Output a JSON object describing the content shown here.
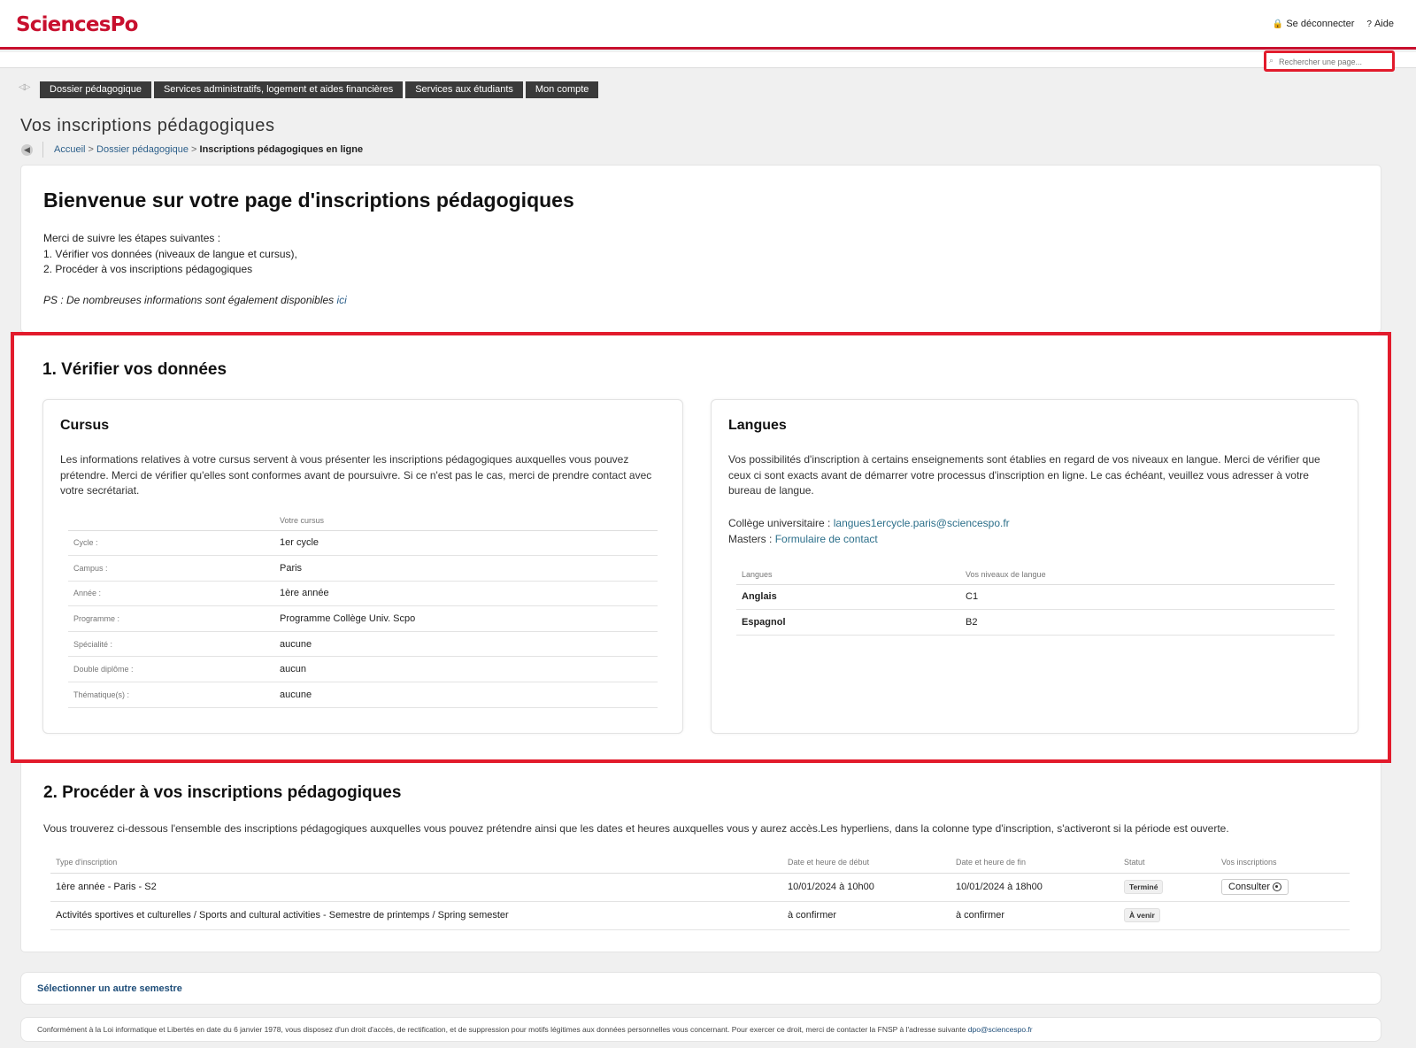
{
  "header": {
    "logo": "SciencesPo",
    "logout_label": "Se déconnecter",
    "help_label": "Aide"
  },
  "search": {
    "placeholder": "Rechercher une page..."
  },
  "nav": {
    "tabs": [
      "Dossier pédagogique",
      "Services administratifs, logement et aides financières",
      "Services aux étudiants",
      "Mon compte"
    ]
  },
  "page": {
    "title": "Vos inscriptions pédagogiques",
    "breadcrumb": {
      "home": "Accueil",
      "parent": "Dossier pédagogique",
      "current": "Inscriptions pédagogiques en ligne"
    }
  },
  "welcome": {
    "heading": "Bienvenue sur votre page d'inscriptions pédagogiques",
    "steps_intro": "Merci de suivre les étapes suivantes :",
    "step1": "1. Vérifier vos données (niveaux de langue et cursus),",
    "step2": "2. Procéder à vos inscriptions pédagogiques",
    "ps_text": "PS : De nombreuses informations sont également disponibles ",
    "ps_link": "ici"
  },
  "section1": {
    "title": "1. Vérifier vos données",
    "cursus": {
      "title": "Cursus",
      "description": "Les informations relatives à votre cursus servent à vous présenter les inscriptions pédagogiques auxquelles vous pouvez prétendre. Merci de vérifier qu'elles sont conformes avant de poursuivre. Si ce n'est pas le cas, merci de prendre contact avec votre secrétariat.",
      "column_header": "Votre cursus",
      "rows": [
        {
          "label": "Cycle :",
          "value": "1er cycle"
        },
        {
          "label": "Campus :",
          "value": "Paris"
        },
        {
          "label": "Année :",
          "value": "1ère année"
        },
        {
          "label": "Programme :",
          "value": "Programme Collège Univ. Scpo"
        },
        {
          "label": "Spécialité :",
          "value": "aucune"
        },
        {
          "label": "Double diplôme :",
          "value": "aucun"
        },
        {
          "label": "Thématique(s) :",
          "value": "aucune"
        }
      ]
    },
    "langues": {
      "title": "Langues",
      "description": "Vos possibilités d'inscription à certains enseignements sont établies en regard de vos niveaux en langue. Merci de vérifier que ceux ci sont exacts avant de démarrer votre processus d'inscription en ligne. Le cas échéant, veuillez vous adresser à votre bureau de langue.",
      "college_label": "Collège universitaire : ",
      "college_email": "langues1ercycle.paris@sciencespo.fr",
      "masters_label": "Masters : ",
      "masters_link": "Formulaire de contact",
      "headers": [
        "Langues",
        "Vos niveaux de langue"
      ],
      "rows": [
        {
          "language": "Anglais",
          "level": "C1"
        },
        {
          "language": "Espagnol",
          "level": "B2"
        }
      ]
    }
  },
  "section2": {
    "title": "2. Procéder à vos inscriptions pédagogiques",
    "description": "Vous trouverez ci-dessous l'ensemble des inscriptions pédagogiques auxquelles vous pouvez prétendre ainsi que les dates et heures auxquelles vous y aurez accès.Les hyperliens, dans la colonne type d'inscription, s'activeront si la période est ouverte.",
    "headers": [
      "Type d'inscription",
      "Date et heure de début",
      "Date et heure de fin",
      "Statut",
      "Vos inscriptions"
    ],
    "rows": [
      {
        "type": "1ère année - Paris - S2",
        "start": "10/01/2024 à 10h00",
        "end": "10/01/2024 à 18h00",
        "status": "Terminé",
        "action": "Consulter"
      },
      {
        "type": "Activités sportives et culturelles / Sports and cultural activities - Semestre de printemps / Spring semester",
        "start": "à confirmer",
        "end": "à confirmer",
        "status": "À venir",
        "action": ""
      }
    ]
  },
  "footer": {
    "select_semester": "Sélectionner un autre semestre",
    "legal_text": "Conformément à la Loi informatique et Libertés en date du 6 janvier 1978, vous disposez d'un droit d'accès, de rectification, et de suppression pour motifs légitimes aux données personnelles vous concernant. Pour exercer ce droit, merci de contacter la FNSP à l'adresse suivante ",
    "legal_email": "dpo@sciencespo.fr"
  },
  "colors": {
    "brand": "#c8102e",
    "highlight": "#e21b2c",
    "link": "#2c5f8a",
    "nav_bg": "#3a3a3a"
  }
}
